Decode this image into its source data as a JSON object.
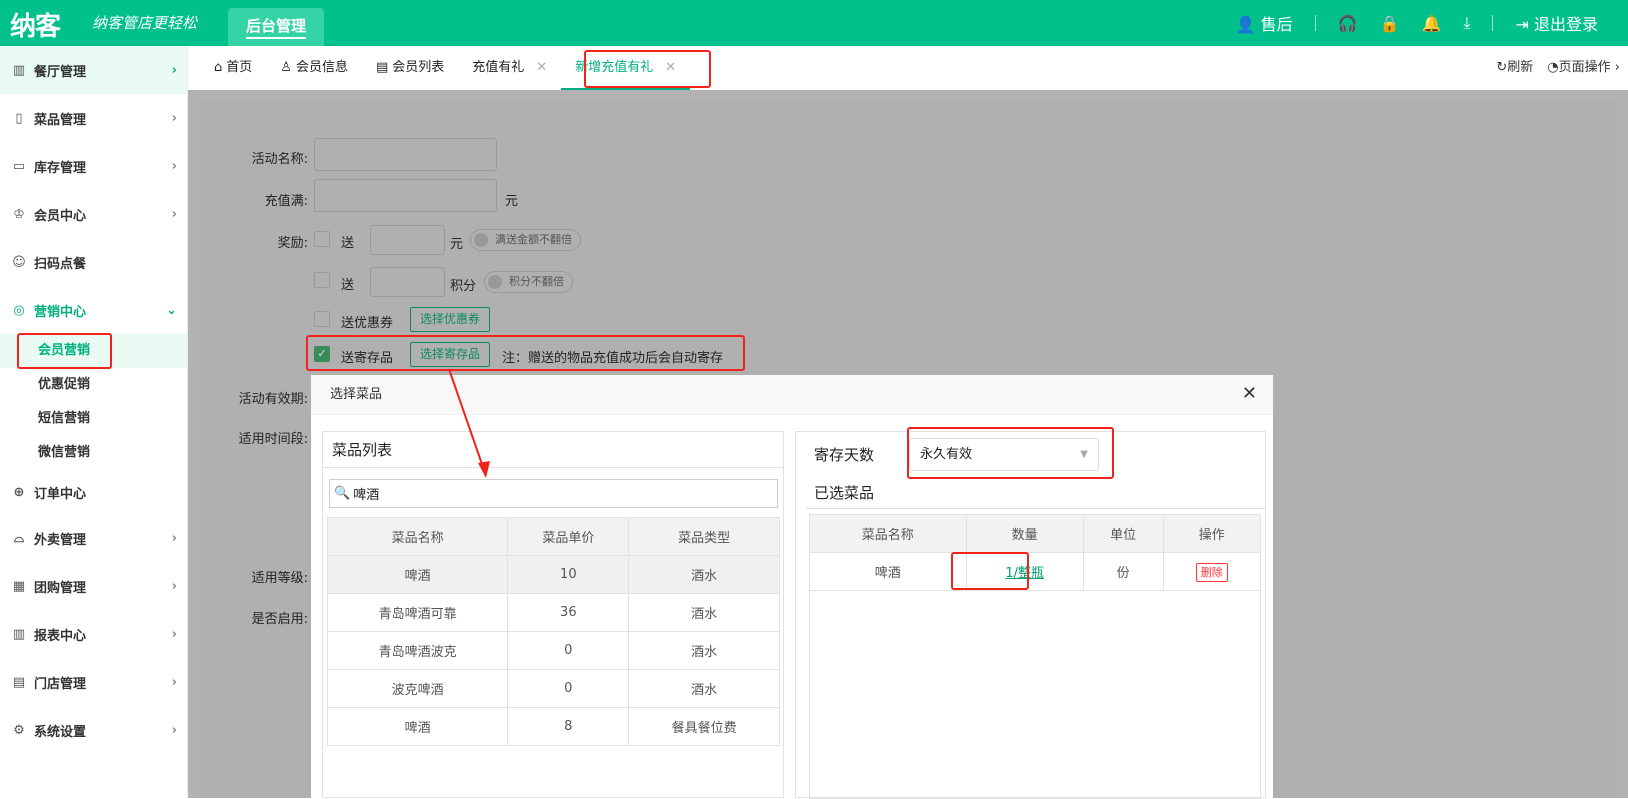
{
  "header": {
    "logo": "纳客",
    "slogan": "纳客管店更轻松",
    "nav_tab": "后台管理",
    "after_sales": "售后",
    "logout": "退出登录",
    "brand_color": "#00c08b"
  },
  "sidebar": {
    "items": [
      {
        "label": "餐厅管理",
        "icon": "building-icon"
      },
      {
        "label": "菜品管理",
        "icon": "layout-icon"
      },
      {
        "label": "库存管理",
        "icon": "inventory-icon"
      },
      {
        "label": "会员中心",
        "icon": "crown-icon"
      },
      {
        "label": "扫码点餐",
        "icon": "user-icon"
      },
      {
        "label": "营销中心",
        "icon": "target-icon"
      },
      {
        "label": "订单中心",
        "icon": "globe-icon"
      },
      {
        "label": "外卖管理",
        "icon": "bell-dish-icon"
      },
      {
        "label": "团购管理",
        "icon": "calendar-icon"
      },
      {
        "label": "报表中心",
        "icon": "chart-icon"
      },
      {
        "label": "门店管理",
        "icon": "store-icon"
      },
      {
        "label": "系统设置",
        "icon": "gear-icon"
      }
    ],
    "sub_items": [
      "会员营销",
      "优惠促销",
      "短信营销",
      "微信营销"
    ]
  },
  "tabs": [
    {
      "label": "首页"
    },
    {
      "label": "会员信息"
    },
    {
      "label": "会员列表"
    },
    {
      "label": "充值有礼"
    },
    {
      "label": "新增充值有礼"
    }
  ],
  "tab_actions": {
    "refresh": "刷新",
    "page_ops": "页面操作"
  },
  "form": {
    "name_label": "活动名称:",
    "recharge_label": "充值满:",
    "yuan": "元",
    "reward_label": "奖励:",
    "send": "送",
    "points": "积分",
    "toggle_amount": "满送金额不翻倍",
    "toggle_points": "积分不翻倍",
    "coupon": "送优惠券",
    "choose_coupon": "选择优惠券",
    "deposit": "送寄存品",
    "choose_deposit": "选择寄存品",
    "note": "注：赠送的物品充值成功后会自动寄存",
    "validity_label": "活动有效期:",
    "time_label": "适用时间段:",
    "level_label": "适用等级:",
    "enabled_label": "是否启用:"
  },
  "modal": {
    "title": "选择菜品",
    "list_title": "菜品列表",
    "search_value": "啤酒",
    "columns": [
      "菜品名称",
      "菜品单价",
      "菜品类型"
    ],
    "rows": [
      [
        "啤酒",
        "10",
        "酒水"
      ],
      [
        "青岛啤酒可靠",
        "36",
        "酒水"
      ],
      [
        "青岛啤酒波克",
        "0",
        "酒水"
      ],
      [
        "波克啤酒",
        "0",
        "酒水"
      ],
      [
        "啤酒",
        "8",
        "餐具餐位费"
      ]
    ],
    "days_label": "寄存天数",
    "days_value": "永久有效",
    "selected_title": "已选菜品",
    "sel_columns": [
      "菜品名称",
      "数量",
      "单位",
      "操作"
    ],
    "sel_rows": [
      {
        "name": "啤酒",
        "qty": "1/整瓶",
        "unit": "份",
        "action": "删除"
      }
    ]
  }
}
